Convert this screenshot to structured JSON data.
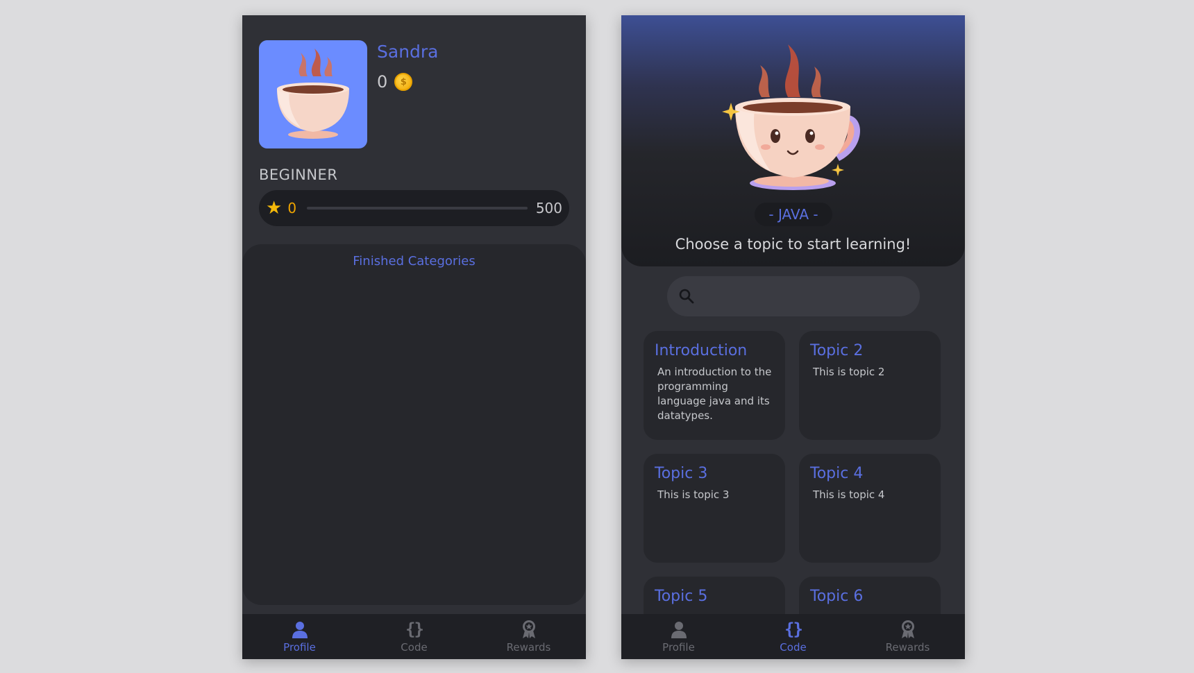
{
  "profile_screen": {
    "user": {
      "name": "Sandra",
      "coins": "0",
      "coin_icon_glyph": "$"
    },
    "level": {
      "label": "BEGINNER",
      "xp_current": "0",
      "xp_max": "500",
      "xp_fraction": 0
    },
    "finished_categories_title": "Finished Categories"
  },
  "code_screen": {
    "language_label": "- JAVA -",
    "subtitle": "Choose a topic to start learning!",
    "search": {
      "placeholder": "",
      "value": ""
    },
    "topics": [
      {
        "title": "Introduction",
        "description": "An introduction to the programming language java and its datatypes."
      },
      {
        "title": "Topic 2",
        "description": "This is topic 2"
      },
      {
        "title": "Topic 3",
        "description": "This is topic 3"
      },
      {
        "title": "Topic 4",
        "description": "This is topic 4"
      },
      {
        "title": "Topic 5",
        "description": ""
      },
      {
        "title": "Topic 6",
        "description": ""
      }
    ]
  },
  "nav": {
    "items": [
      {
        "label": "Profile",
        "icon": "person-icon"
      },
      {
        "label": "Code",
        "icon": "braces-icon"
      },
      {
        "label": "Rewards",
        "icon": "award-badge-icon"
      }
    ],
    "braces_glyph": "{}"
  },
  "colors": {
    "accent": "#5a6fe0",
    "background": "#2f3036",
    "panel": "#26272c",
    "avatar_bg": "#6b8cff",
    "xp_gold": "#f0a500"
  }
}
